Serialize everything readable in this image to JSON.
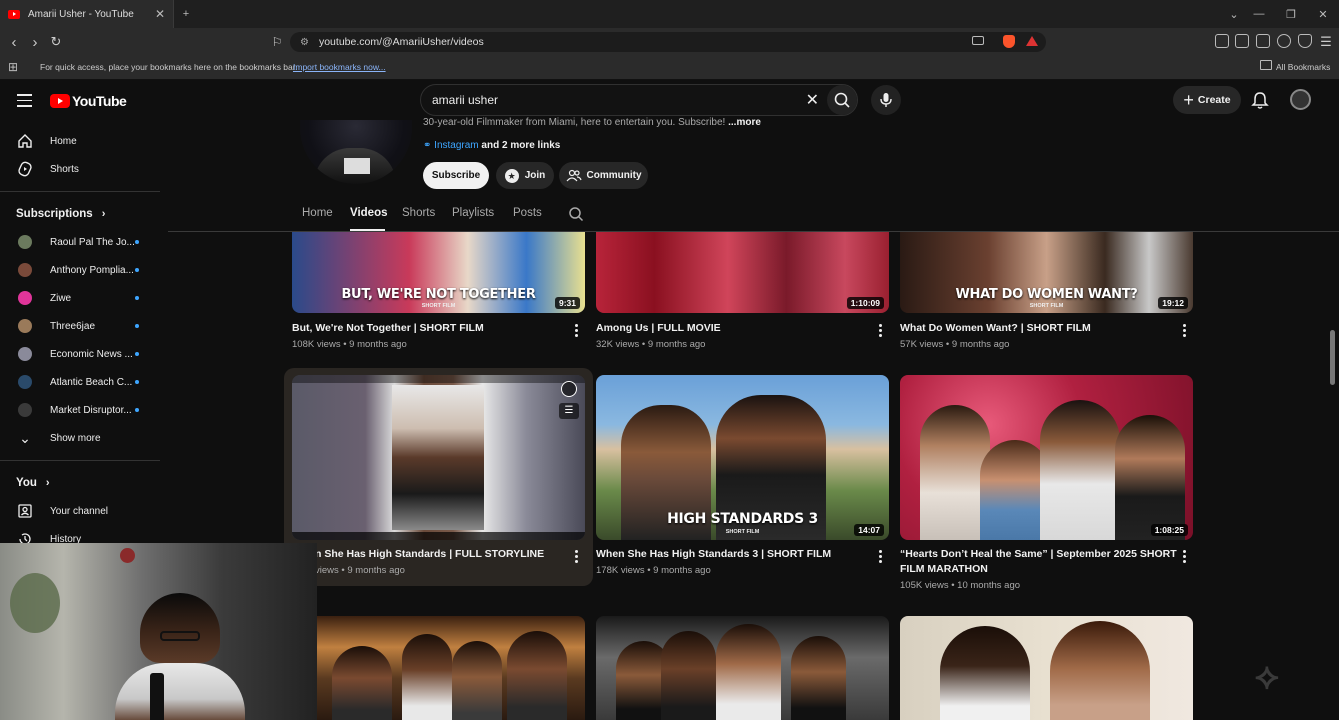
{
  "browser": {
    "tab_title": "Amarii Usher - YouTube",
    "url": "youtube.com/@AmariiUsher/videos",
    "bookmarks_hint": "For quick access, place your bookmarks here on the bookmarks bar.",
    "import_link": "Import bookmarks now...",
    "all_bookmarks": "All Bookmarks"
  },
  "header": {
    "logo_text": "YouTube",
    "search_value": "amarii usher",
    "create_label": "Create"
  },
  "sidebar": {
    "main": [
      {
        "label": "Home"
      },
      {
        "label": "Shorts"
      }
    ],
    "subscriptions_title": "Subscriptions",
    "subscriptions": [
      {
        "label": "Raoul Pal The Jo...",
        "color": "#6b7a5e"
      },
      {
        "label": "Anthony Pomplia...",
        "color": "#7a4a3a"
      },
      {
        "label": "Ziwe",
        "color": "#e0359a"
      },
      {
        "label": "Three6jae",
        "color": "#9a7a5a"
      },
      {
        "label": "Economic News ...",
        "color": "#8a8a9a"
      },
      {
        "label": "Atlantic Beach C...",
        "color": "#2a4a6a"
      },
      {
        "label": "Market Disruptor...",
        "color": "#3a3a3a"
      }
    ],
    "show_more": "Show more",
    "you_title": "You",
    "you_items": [
      {
        "label": "Your channel"
      },
      {
        "label": "History"
      }
    ]
  },
  "channel": {
    "description": "30-year-old Filmmaker from Miami, here to entertain you. Subscribe!",
    "more": "...more",
    "link_name": "Instagram",
    "link_more": "and 2 more links",
    "subscribe": "Subscribe",
    "join": "Join",
    "community": "Community",
    "tabs": [
      "Home",
      "Videos",
      "Shorts",
      "Playlists",
      "Posts"
    ],
    "active_tab": "Videos"
  },
  "videos": [
    {
      "title": "But, We're Not Together | SHORT FILM",
      "meta": "108K views • 9 months ago",
      "duration": "9:31",
      "overlay": "BUT, WE'RE NOT TOGETHER",
      "overlay_sub": "SHORT FILM"
    },
    {
      "title": "Among Us | FULL MOVIE",
      "meta": "32K views • 9 months ago",
      "duration": "1:10:09"
    },
    {
      "title": "What Do Women Want? | SHORT FILM",
      "meta": "57K views • 9 months ago",
      "duration": "19:12",
      "overlay": "WHAT DO WOMEN WANT?",
      "overlay_sub": "SHORT FILM"
    },
    {
      "title": "n She Has High Standards | FULL STORYLINE",
      "meta": "views • 9 months ago"
    },
    {
      "title": "When She Has High Standards 3 | SHORT FILM",
      "meta": "178K views • 9 months ago",
      "duration": "14:07",
      "overlay": "HIGH STANDARDS 3",
      "overlay_sub": "SHORT FILM"
    },
    {
      "title": "“Hearts Don’t Heal the Same” | September 2025 SHORT FILM MARATHON",
      "meta": "105K views • 10 months ago",
      "duration": "1:08:25"
    }
  ]
}
